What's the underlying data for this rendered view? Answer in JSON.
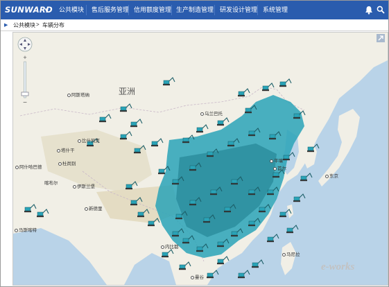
{
  "header": {
    "logo": "SUNWARD",
    "nav": [
      {
        "label": "公共模块"
      },
      {
        "label": "售后服务管理"
      },
      {
        "label": "信用额度管理"
      },
      {
        "label": "生产制造管理"
      },
      {
        "label": "研发设计管理"
      },
      {
        "label": "系统管理"
      }
    ],
    "icons": [
      "bell-icon",
      "search-icon"
    ]
  },
  "breadcrumb": {
    "module": "公共模块",
    "separator": ">",
    "page": "车辆分布"
  },
  "map": {
    "continent_label": "亚洲",
    "places": [
      {
        "name": "阿斯塔纳"
      },
      {
        "name": "乌兰巴托"
      },
      {
        "name": "塔什干"
      },
      {
        "name": "比什凯克"
      },
      {
        "name": "阿什哈巴德"
      },
      {
        "name": "杜尚别"
      },
      {
        "name": "喀布尔"
      },
      {
        "name": "伊斯兰堡"
      },
      {
        "name": "新德里"
      },
      {
        "name": "马斯喀特"
      },
      {
        "name": "平壤"
      },
      {
        "name": "首尔"
      },
      {
        "name": "东京"
      },
      {
        "name": "内比都"
      },
      {
        "name": "马尼拉"
      },
      {
        "name": "曼谷"
      }
    ],
    "marker_icon": "excavator-icon",
    "colors": {
      "water": "#b9d3e8",
      "land": "#f1efe6",
      "marker": "#2aa3b7",
      "header": "#2a5cae"
    }
  },
  "watermark": "e-works"
}
